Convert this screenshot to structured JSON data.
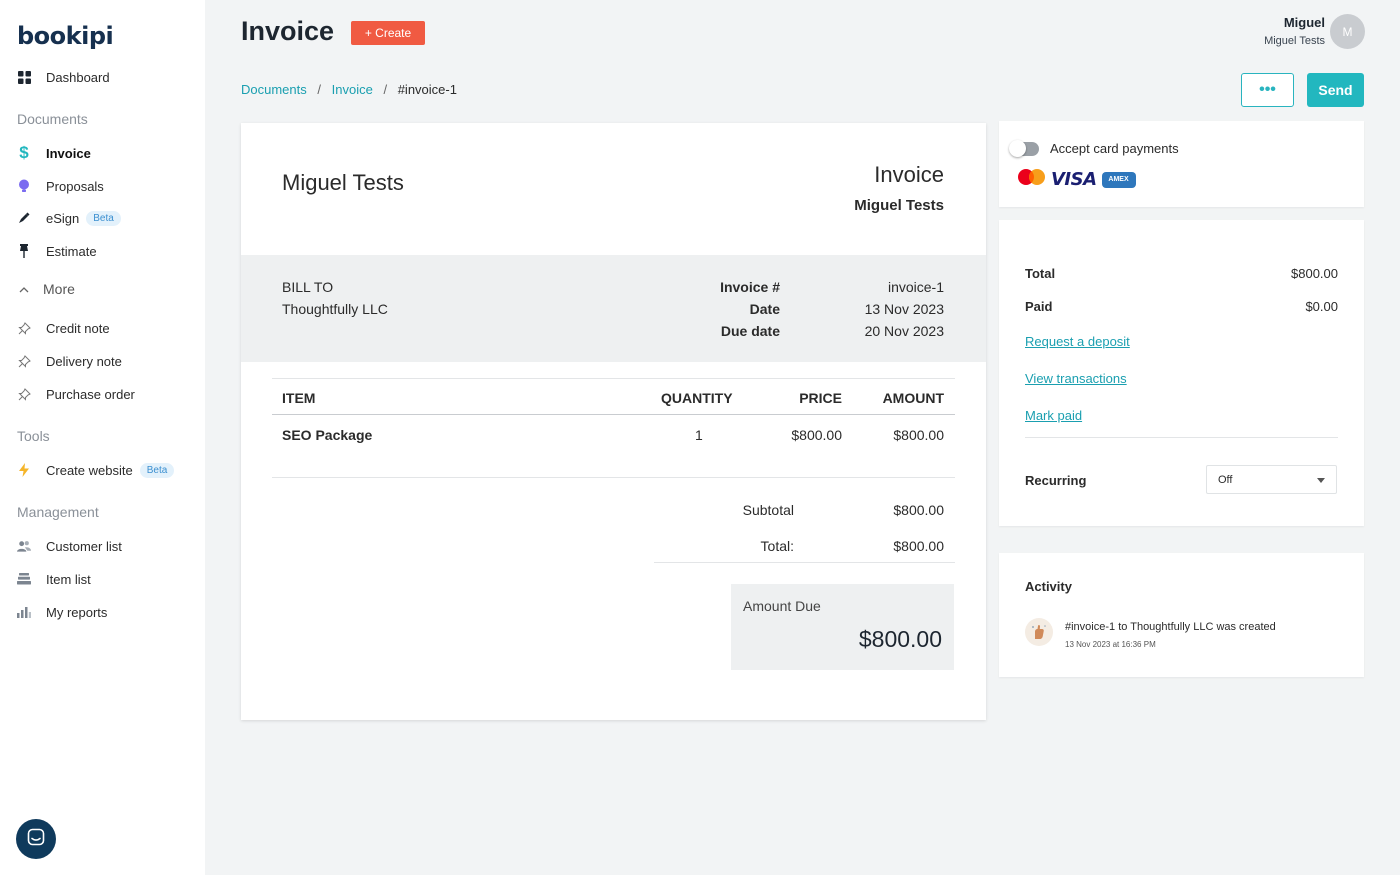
{
  "brand": {
    "logo": "bookipi"
  },
  "sidebar": {
    "dashboard": "Dashboard",
    "sections": {
      "documents": "Documents",
      "more": "More",
      "tools": "Tools",
      "management": "Management"
    },
    "documents": [
      {
        "label": "Invoice",
        "icon": "dollar-icon",
        "active": true
      },
      {
        "label": "Proposals",
        "icon": "bulb-icon"
      },
      {
        "label": "eSign",
        "icon": "pen-icon",
        "badge": "Beta"
      },
      {
        "label": "Estimate",
        "icon": "pin-icon"
      }
    ],
    "more": [
      {
        "label": "Credit note",
        "icon": "pin-outline-icon"
      },
      {
        "label": "Delivery note",
        "icon": "pin-outline-icon"
      },
      {
        "label": "Purchase order",
        "icon": "pin-outline-icon"
      }
    ],
    "tools": [
      {
        "label": "Create website",
        "icon": "bolt-icon",
        "badge": "Beta"
      }
    ],
    "management": [
      {
        "label": "Customer list",
        "icon": "users-icon"
      },
      {
        "label": "Item list",
        "icon": "stack-icon"
      },
      {
        "label": "My reports",
        "icon": "bar-chart-icon"
      }
    ]
  },
  "header": {
    "title": "Invoice",
    "create_label": "+ Create",
    "user_name": "Miguel",
    "user_org": "Miguel Tests",
    "avatar_initial": "M"
  },
  "breadcrumb": {
    "documents": "Documents",
    "invoice": "Invoice",
    "current": "#invoice-1"
  },
  "actions": {
    "more_label": "•••",
    "send_label": "Send"
  },
  "invoice": {
    "company": "Miguel Tests",
    "doc_type": "Invoice",
    "doc_owner": "Miguel Tests",
    "bill_to_label": "BILL TO",
    "bill_to_name": "Thoughtfully LLC",
    "meta": {
      "number_label": "Invoice #",
      "number": "invoice-1",
      "date_label": "Date",
      "date": "13 Nov 2023",
      "due_label": "Due date",
      "due": "20 Nov 2023"
    },
    "columns": {
      "item": "ITEM",
      "quantity": "QUANTITY",
      "price": "PRICE",
      "amount": "AMOUNT"
    },
    "items": [
      {
        "name": "SEO Package",
        "quantity": "1",
        "price": "$800.00",
        "amount": "$800.00"
      }
    ],
    "subtotal_label": "Subtotal",
    "subtotal": "$800.00",
    "total_label": "Total:",
    "total": "$800.00",
    "amount_due_label": "Amount Due",
    "amount_due": "$800.00"
  },
  "payments": {
    "accept_label": "Accept card payments",
    "accept_enabled": false,
    "amex_label": "AMEX"
  },
  "summary": {
    "total_label": "Total",
    "total": "$800.00",
    "paid_label": "Paid",
    "paid": "$0.00",
    "links": {
      "deposit": "Request a deposit",
      "transactions": "View transactions",
      "mark_paid": "Mark paid"
    },
    "recurring_label": "Recurring",
    "recurring_value": "Off"
  },
  "activity": {
    "title": "Activity",
    "entries": [
      {
        "text": "#invoice-1 to Thoughtfully LLC was created",
        "time": "13 Nov 2023 at 16:36 PM"
      }
    ]
  },
  "colors": {
    "accent": "#22b7bf",
    "create": "#f05a42",
    "link": "#1a9fb0"
  }
}
